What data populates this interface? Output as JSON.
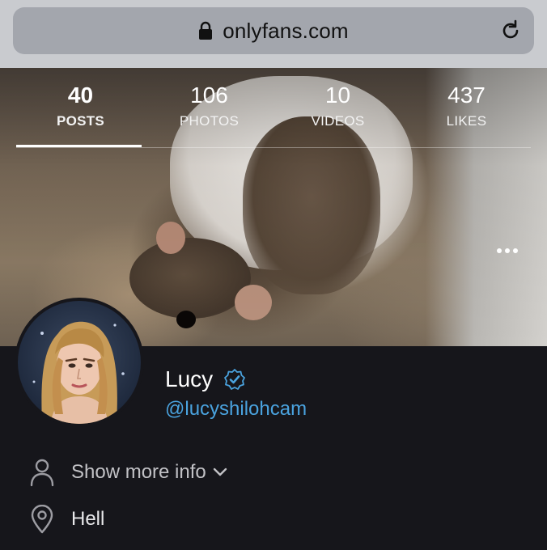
{
  "browser": {
    "url": "onlyfans.com",
    "lock_icon": "lock-icon",
    "reload_icon": "reload-icon"
  },
  "stats": [
    {
      "value": "40",
      "label": "POSTS",
      "active": true
    },
    {
      "value": "106",
      "label": "PHOTOS",
      "active": false
    },
    {
      "value": "10",
      "label": "VIDEOS",
      "active": false
    },
    {
      "value": "437",
      "label": "LIKES",
      "active": false
    }
  ],
  "profile": {
    "name": "Lucy",
    "handle": "@lucyshilohcam",
    "verified_icon": "verified-badge-icon",
    "show_more_label": "Show more info",
    "location": "Hell"
  },
  "colors": {
    "background": "#16161b",
    "handle": "#4aa3df",
    "verified": "#4aa3df",
    "url_bar": "#a3a6ad"
  }
}
